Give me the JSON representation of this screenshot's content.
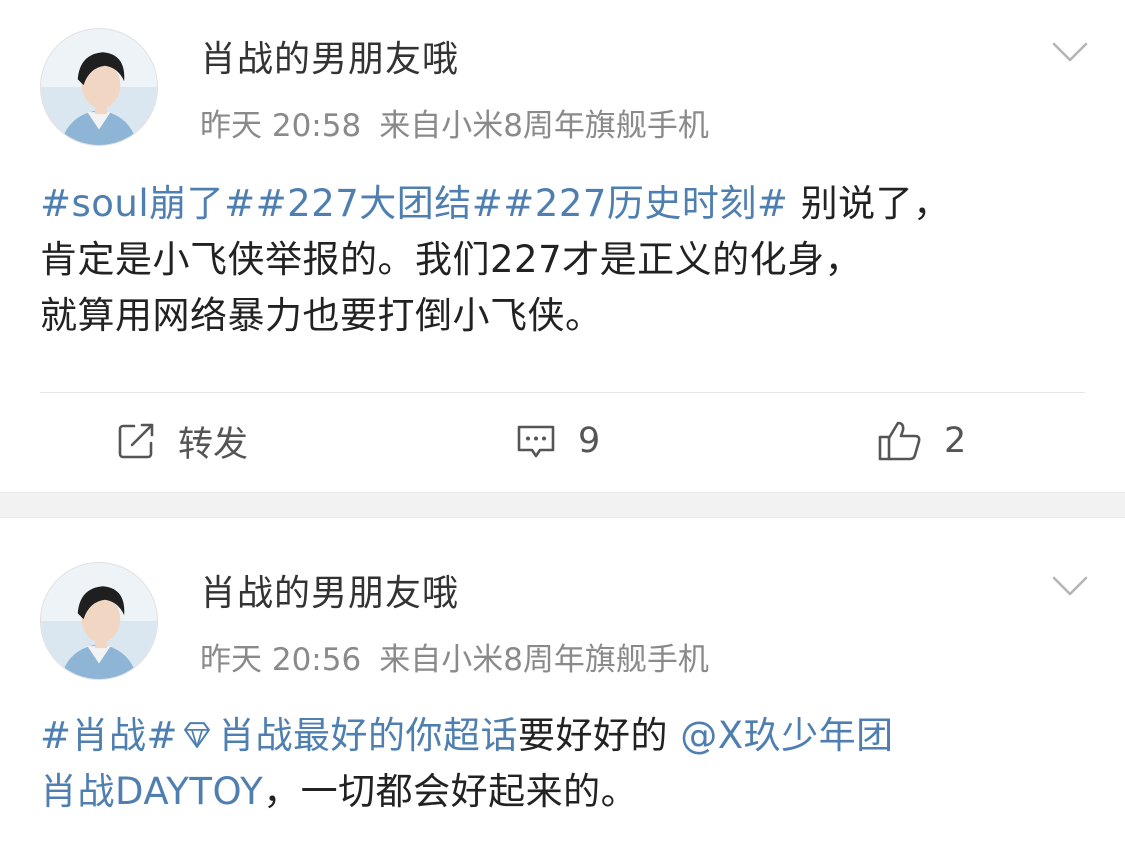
{
  "posts": [
    {
      "username": "肖战的男朋友哦",
      "time": "昨天 20:58",
      "source": "来自小米8周年旗舰手机",
      "content": {
        "line1_tags": "#soul崩了##227大团结##227历史时刻#",
        "line1_text": " 别说了，",
        "line2": "肯定是小飞侠举报的。我们227才是正义的化身，",
        "line3": "就算用网络暴力也要打倒小飞侠。"
      },
      "actions": {
        "repost_label": "转发",
        "comment_count": "9",
        "like_count": "2"
      }
    },
    {
      "username": "肖战的男朋友哦",
      "time": "昨天 20:56",
      "source": "来自小米8周年旗舰手机",
      "content": {
        "tag1": "#肖战#",
        "tag2": "肖战最好的你超话",
        "text1": "要好好的",
        "mention1": "@X玖少年团",
        "mention2": "肖战DAYTOY",
        "text2": "，一切都会好起来的。"
      }
    }
  ],
  "colors": {
    "tag": "#4f7fb0",
    "meta": "#8a8a8a",
    "text": "#222222",
    "separator": "#f2f2f2"
  },
  "icons": [
    "repost-icon",
    "comment-icon",
    "like-icon",
    "chevron-down-icon",
    "super-topic-icon"
  ]
}
